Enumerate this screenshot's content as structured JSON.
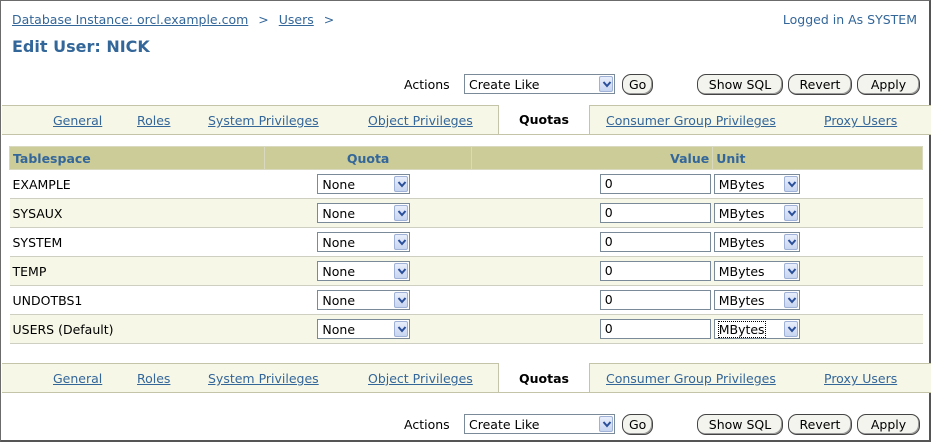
{
  "header": {
    "breadcrumb": [
      "Database Instance: orcl.example.com",
      "Users"
    ],
    "separator": ">",
    "logged_in": "Logged in As SYSTEM",
    "title": "Edit User: NICK"
  },
  "actions": {
    "label": "Actions",
    "selected": "Create Like",
    "go": "Go",
    "show_sql": "Show SQL",
    "revert": "Revert",
    "apply": "Apply"
  },
  "tabs": [
    {
      "label": "General",
      "active": false
    },
    {
      "label": "Roles",
      "active": false
    },
    {
      "label": "System Privileges",
      "active": false
    },
    {
      "label": "Object Privileges",
      "active": false
    },
    {
      "label": "Quotas",
      "active": true
    },
    {
      "label": "Consumer Group Privileges",
      "active": false
    },
    {
      "label": "Proxy Users",
      "active": false
    }
  ],
  "table": {
    "columns": [
      "Tablespace",
      "Quota",
      "Value",
      "Unit"
    ],
    "rows": [
      {
        "tablespace": "EXAMPLE",
        "quota": "None",
        "value": "0",
        "unit": "MBytes"
      },
      {
        "tablespace": "SYSAUX",
        "quota": "None",
        "value": "0",
        "unit": "MBytes"
      },
      {
        "tablespace": "SYSTEM",
        "quota": "None",
        "value": "0",
        "unit": "MBytes"
      },
      {
        "tablespace": "TEMP",
        "quota": "None",
        "value": "0",
        "unit": "MBytes"
      },
      {
        "tablespace": "UNDOTBS1",
        "quota": "None",
        "value": "0",
        "unit": "MBytes"
      },
      {
        "tablespace": "USERS (Default)",
        "quota": "None",
        "value": "0",
        "unit": "MBytes"
      }
    ]
  },
  "colors": {
    "link": "#336699",
    "header_bg": "#cccc99",
    "tab_bg": "#f7f7e7"
  },
  "icons": {
    "dropdown": "chevron-down-icon"
  }
}
